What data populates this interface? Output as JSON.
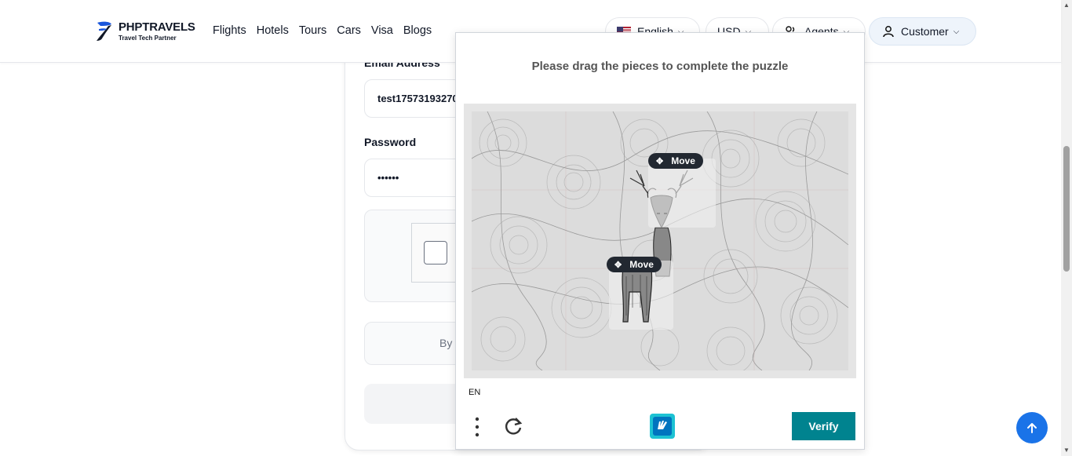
{
  "brand": {
    "name": "PHPTRAVELS",
    "tagline": "Travel Tech Partner"
  },
  "nav": [
    "Flights",
    "Hotels",
    "Tours",
    "Cars",
    "Visa",
    "Blogs"
  ],
  "header_controls": {
    "language": "English",
    "currency": "USD",
    "agents": "Agents",
    "customer": "Customer"
  },
  "form": {
    "email_label": "Email Address",
    "email_value": "test17573193270",
    "password_label": "Password",
    "password_value": "••••••",
    "terms_text": "By"
  },
  "puzzle": {
    "title": "Please drag the pieces to complete the puzzle",
    "move_label": "Move",
    "language": "EN",
    "verify_label": "Verify"
  },
  "colors": {
    "verify": "#00838f",
    "scroll_top": "#1a73e8",
    "brand_blue": "#1a56db"
  },
  "icons": [
    "flag-us-icon",
    "chevron-down-icon",
    "agents-icon",
    "user-icon",
    "move-icon",
    "more-vertical-icon",
    "refresh-icon",
    "hcaptcha-logo-icon",
    "arrow-up-icon"
  ]
}
